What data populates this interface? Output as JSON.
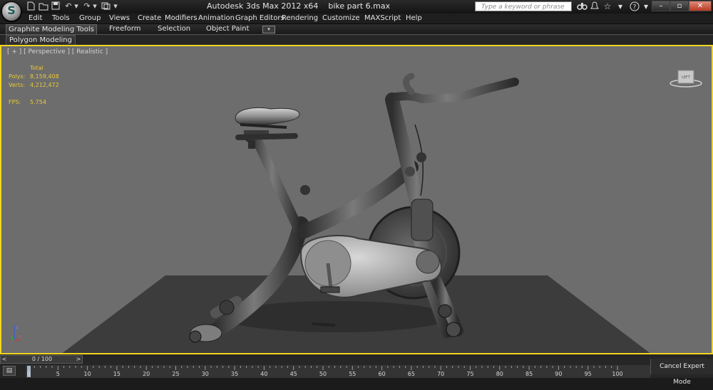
{
  "window": {
    "title_app": "Autodesk 3ds Max  2012 x64",
    "title_file": "bike part 6.max",
    "search_placeholder": "Type a keyword or phrase",
    "logo_letter": "S"
  },
  "quick_access": [
    "new-file-icon",
    "open-file-icon",
    "save-icon",
    "undo-icon",
    "redo-icon",
    "project-folder-icon"
  ],
  "header_icons": [
    "binoculars-icon",
    "globe-icon",
    "star-icon",
    "help-icon"
  ],
  "menu": [
    "Edit",
    "Tools",
    "Group",
    "Views",
    "Create",
    "Modifiers",
    "Animation",
    "Graph Editors",
    "Rendering",
    "Customize",
    "MAXScript",
    "Help"
  ],
  "ribbon": {
    "tabs": [
      "Graphite Modeling Tools",
      "Freeform",
      "Selection",
      "Object Paint"
    ],
    "panel": "Polygon Modeling"
  },
  "viewport": {
    "label": "[ + ] [ Perspective ] [ Realistic ]",
    "stats": {
      "header": "Total",
      "polys_label": "Polys:",
      "polys_value": "8,159,408",
      "verts_label": "Verts:",
      "verts_value": "4,212,472",
      "fps_label": "FPS:",
      "fps_value": "5.754"
    },
    "viewcube_label": "LEFT",
    "border_color": "#f1d51f",
    "background": "#6d6d6d"
  },
  "timeline": {
    "frame_readout": "0 / 100",
    "current_frame": 0,
    "ticks": [
      "0",
      "5",
      "10",
      "15",
      "20",
      "25",
      "30",
      "35",
      "40",
      "45",
      "50",
      "55",
      "60",
      "65",
      "70",
      "75",
      "80",
      "85",
      "90",
      "95",
      "100"
    ]
  },
  "status": {
    "cancel_expert": "Cancel Expert Mode"
  }
}
